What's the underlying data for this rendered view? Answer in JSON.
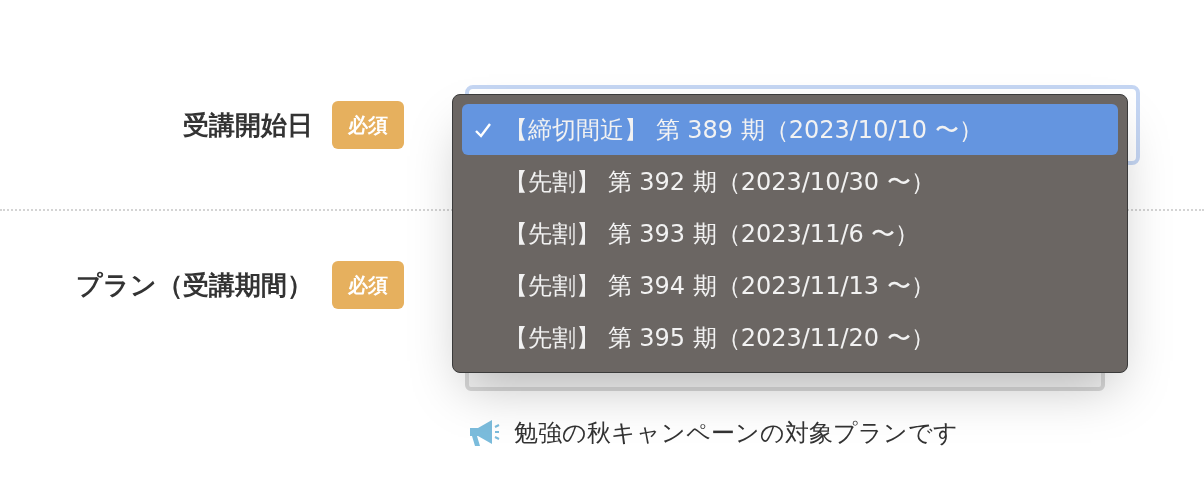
{
  "fields": [
    {
      "label": "受講開始日",
      "badge": "必須"
    },
    {
      "label": "プラン（受講期間）",
      "badge": "必須"
    }
  ],
  "dropdown": {
    "options": [
      {
        "label": "【締切間近】 第 389 期（2023/10/10 〜）",
        "selected": true
      },
      {
        "label": "【先割】 第 392 期（2023/10/30 〜）",
        "selected": false
      },
      {
        "label": "【先割】 第 393 期（2023/11/6 〜）",
        "selected": false
      },
      {
        "label": "【先割】 第 394 期（2023/11/13 〜）",
        "selected": false
      },
      {
        "label": "【先割】 第 395 期（2023/11/20 〜）",
        "selected": false
      }
    ]
  },
  "note": "勉強の秋キャンペーンの対象プランです"
}
